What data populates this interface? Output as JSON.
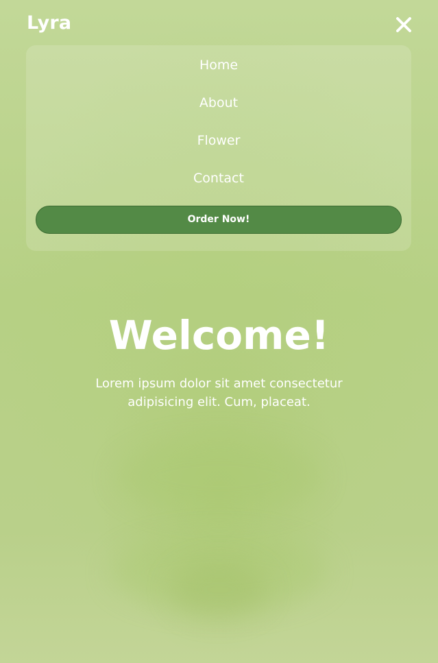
{
  "header": {
    "logo": "Lyra",
    "close_icon": "close-icon"
  },
  "menu": {
    "items": [
      {
        "label": "Home"
      },
      {
        "label": "About"
      },
      {
        "label": "Flower"
      },
      {
        "label": "Contact"
      }
    ],
    "order_button": "Order Now!"
  },
  "hero": {
    "title": "Welcome!",
    "text": "Lorem ipsum dolor sit amet consectetur adipisicing elit. Cum, placeat."
  },
  "colors": {
    "background": "#b9d08a",
    "order_button_bg": "#538a46",
    "text": "#ffffff"
  }
}
